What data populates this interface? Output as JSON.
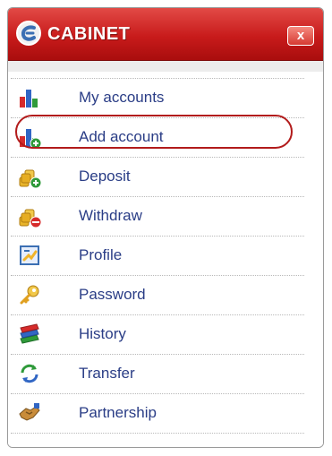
{
  "cabinet": {
    "title": "CABINET",
    "close_label": "x"
  },
  "menu": [
    {
      "label": "My accounts",
      "icon": "bar-chart-icon"
    },
    {
      "label": "Add account",
      "icon": "bar-chart-plus-icon"
    },
    {
      "label": "Deposit",
      "icon": "coins-plus-icon"
    },
    {
      "label": "Withdraw",
      "icon": "coins-minus-icon"
    },
    {
      "label": "Profile",
      "icon": "profile-icon"
    },
    {
      "label": "Password",
      "icon": "key-icon"
    },
    {
      "label": "History",
      "icon": "books-icon"
    },
    {
      "label": "Transfer",
      "icon": "refresh-arrows-icon"
    },
    {
      "label": "Partnership",
      "icon": "handshake-icon"
    }
  ],
  "colors": {
    "header": "#c81b1b",
    "link": "#2a3d86",
    "highlight_ring": "#b21b1b"
  }
}
